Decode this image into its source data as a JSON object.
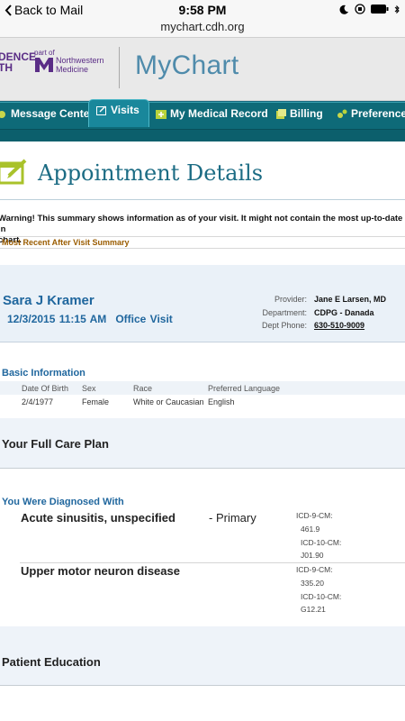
{
  "status_bar": {
    "back_label": "Back to Mail",
    "time": "9:58 PM",
    "url": "mychart.cdh.org"
  },
  "branding": {
    "left_logo_text_1": "DENCE",
    "left_logo_text_2": "TH",
    "part_of": "part of",
    "northwestern_1": "Northwestern",
    "northwestern_2": "Medicine",
    "app_name": "MyChart",
    "brand_color": "#4f8bab",
    "purple": "#5a2d86"
  },
  "nav": {
    "tabs": [
      {
        "label": "Message Center",
        "icon": "envelope-icon"
      },
      {
        "label": "Visits",
        "icon": "calendar-edit-icon",
        "active": true
      },
      {
        "label": "My Medical Record",
        "icon": "plus-folder-icon"
      },
      {
        "label": "Billing",
        "icon": "billing-icon"
      },
      {
        "label": "Preferences",
        "icon": "gear-icon"
      }
    ]
  },
  "page": {
    "title": "Appointment Details",
    "warning": "Warning! This summary shows information as of your visit. It might not contain the most up-to-date information about your health. Please refer to the rest of MyChart.",
    "warning_line_1": "Warning! This summary shows information as of your visit. It might not contain the most up-to-date in",
    "warning_line_2": "chart.",
    "most_recent": "Most Recent After Visit Summary"
  },
  "visit": {
    "patient_name": "Sara J Kramer",
    "datetime": "12/3/2015 11:15 AM",
    "type": "Office Visit",
    "provider_label": "Provider:",
    "provider": "Jane E Larsen, MD",
    "department_label": "Department:",
    "department": "CDPG - Danada",
    "phone_label": "Dept Phone:",
    "phone": "630-510-9009"
  },
  "basic_info": {
    "heading": "Basic Information",
    "headers": [
      "Date Of Birth",
      "Sex",
      "Race",
      "Preferred Language"
    ],
    "row": [
      "2/4/1977",
      "Female",
      "White or Caucasian",
      "English"
    ]
  },
  "care_plan": {
    "title": "Your Full Care Plan"
  },
  "diagnoses": {
    "heading": "You Were Diagnosed With",
    "items": [
      {
        "name": "Acute sinusitis, unspecified",
        "primary": "-  Primary",
        "codes": [
          "ICD-9-CM:",
          "461.9",
          "ICD-10-CM:",
          "J01.90"
        ]
      },
      {
        "name": "Upper motor neuron disease",
        "codes": [
          "ICD-9-CM:",
          "335.20",
          "ICD-10-CM:",
          "G12.21"
        ]
      }
    ]
  },
  "patient_education": {
    "title": "Patient Education"
  }
}
